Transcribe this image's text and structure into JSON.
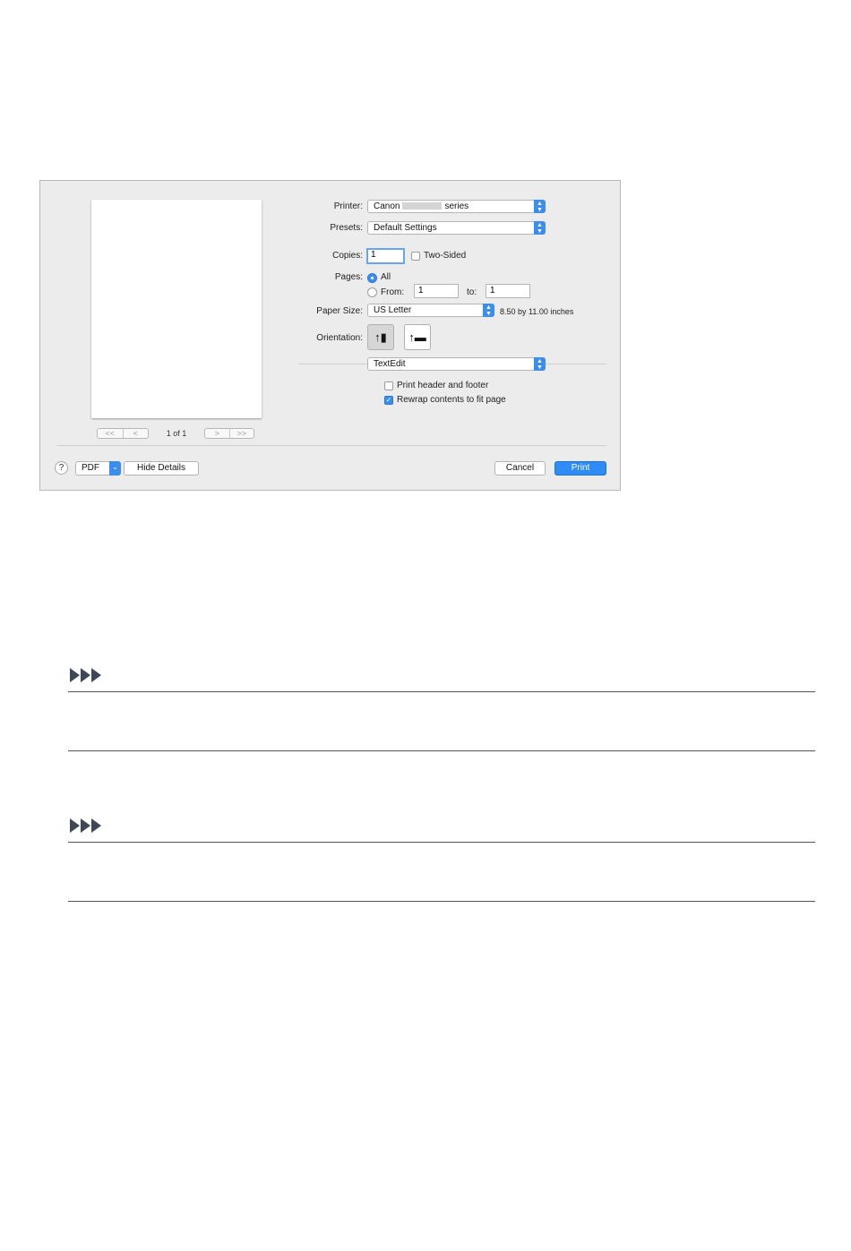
{
  "dialog": {
    "printer": {
      "label": "Printer:",
      "value_prefix": "Canon",
      "value_suffix": "series"
    },
    "presets": {
      "label": "Presets:",
      "value": "Default Settings"
    },
    "copies": {
      "label": "Copies:",
      "value": "1",
      "two_sided_label": "Two-Sided",
      "two_sided_checked": false
    },
    "pages": {
      "label": "Pages:",
      "all_label": "All",
      "from_label": "From:",
      "from_value": "1",
      "to_label": "to:",
      "to_value": "1",
      "selected": "All"
    },
    "paper_size": {
      "label": "Paper Size:",
      "value": "US Letter",
      "dimensions": "8.50 by 11.00 inches"
    },
    "orientation": {
      "label": "Orientation:",
      "selected": "portrait"
    },
    "app_section": {
      "value": "TextEdit"
    },
    "options": [
      {
        "label": "Print header and footer",
        "checked": false
      },
      {
        "label": "Rewrap contents to fit page",
        "checked": true
      }
    ],
    "preview": {
      "page_count": "1 of 1",
      "first": "<<",
      "prev": "<",
      "next": ">",
      "last": ">>"
    },
    "footer": {
      "help": "?",
      "pdf_label": "PDF",
      "hide_details_label": "Hide Details",
      "cancel_label": "Cancel",
      "print_label": "Print"
    }
  },
  "colors": {
    "accent": "#3b8ef0",
    "note_icon": "#3f4656"
  }
}
